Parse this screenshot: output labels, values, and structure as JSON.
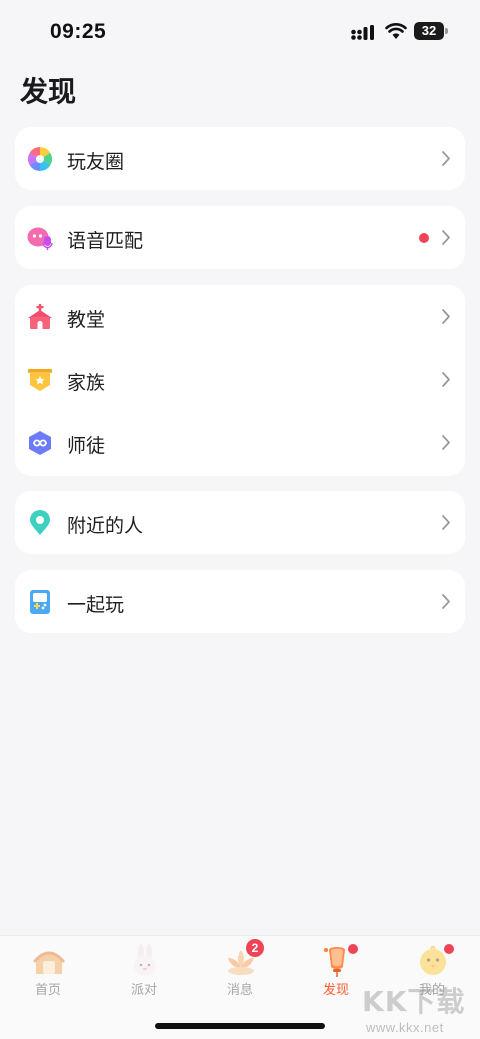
{
  "status_bar": {
    "time": "09:25",
    "battery": "32"
  },
  "page": {
    "title": "发现"
  },
  "sections": [
    {
      "items": [
        {
          "label": "玩友圈",
          "icon": "camera-aperture-icon",
          "dot": false
        }
      ]
    },
    {
      "items": [
        {
          "label": "语音匹配",
          "icon": "voice-match-icon",
          "dot": true
        }
      ]
    },
    {
      "items": [
        {
          "label": "教堂",
          "icon": "church-icon",
          "dot": false
        },
        {
          "label": "家族",
          "icon": "family-shield-icon",
          "dot": false
        },
        {
          "label": "师徒",
          "icon": "mentor-hexagon-icon",
          "dot": false
        }
      ]
    },
    {
      "items": [
        {
          "label": "附近的人",
          "icon": "location-pin-icon",
          "dot": false
        }
      ]
    },
    {
      "items": [
        {
          "label": "一起玩",
          "icon": "game-console-icon",
          "dot": false
        }
      ]
    }
  ],
  "tab_bar": {
    "tabs": [
      {
        "label": "首页",
        "icon": "home-icon",
        "active": false
      },
      {
        "label": "派对",
        "icon": "party-rabbit-icon",
        "active": false
      },
      {
        "label": "消息",
        "icon": "message-lotus-icon",
        "active": false,
        "badge": "2"
      },
      {
        "label": "发现",
        "icon": "discover-lantern-icon",
        "active": true,
        "dot": true
      },
      {
        "label": "我的",
        "icon": "profile-chick-icon",
        "active": false,
        "dot": true
      }
    ]
  },
  "watermark": {
    "big": "KK下载",
    "small": "www.kkx.net"
  },
  "colors": {
    "accent": "#ff5a2e",
    "badge": "#f04456",
    "background": "#f6f6f9"
  }
}
